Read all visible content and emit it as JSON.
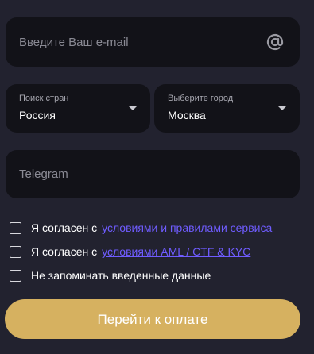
{
  "email": {
    "placeholder": "Введите Ваш e-mail",
    "icon": "at-icon"
  },
  "country": {
    "label": "Поиск стран",
    "value": "Россия"
  },
  "city": {
    "label": "Выберите город",
    "value": "Москва"
  },
  "telegram": {
    "placeholder": "Telegram"
  },
  "agreements": [
    {
      "text": "Я согласен с",
      "link": "условиями и правилами сервиса",
      "checked": false
    },
    {
      "text": "Я согласен с",
      "link": "условиями AML / CTF & KYC",
      "checked": false
    },
    {
      "text": "Не запоминать введенные данные",
      "checked": false
    }
  ],
  "pay_button": {
    "label": "Перейти к оплате"
  },
  "colors": {
    "background": "#22222f",
    "field": "#121218",
    "accent": "#d6b160",
    "link": "#6f5cff"
  }
}
